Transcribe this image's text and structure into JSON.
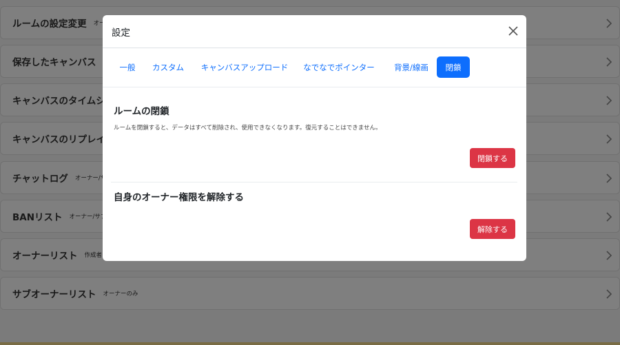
{
  "background": {
    "rows": [
      {
        "title": "ルームの設定変更",
        "note": "オー"
      },
      {
        "title": "保存したキャンバス",
        "note": ""
      },
      {
        "title": "キャンバスのタイムシ",
        "note": ""
      },
      {
        "title": "キャンバスのリプレイ",
        "note": ""
      },
      {
        "title": "チャットログ",
        "note": "オーナー/サ"
      },
      {
        "title": "BANリスト",
        "note": "オーナー/サブ"
      },
      {
        "title": "オーナーリスト",
        "note": "作成者"
      },
      {
        "title": "サブオーナーリスト",
        "note": "オーナーのみ"
      }
    ]
  },
  "modal": {
    "title": "設定",
    "tabs": [
      {
        "label": "一般"
      },
      {
        "label": "カスタム"
      },
      {
        "label": "キャンバスアップロード"
      },
      {
        "label": "なでなでポインター"
      },
      {
        "label": "背景/線画"
      },
      {
        "label": "閉鎖"
      }
    ],
    "active_tab": "閉鎖",
    "close_section": {
      "title": "ルームの閉鎖",
      "description": "ルームを閉鎖すると、データはすべて削除され、使用できなくなります。復元することはできません。",
      "button_label": "閉鎖する"
    },
    "owner_section": {
      "title": "自身のオーナー権限を解除する",
      "button_label": "解除する"
    }
  },
  "colors": {
    "primary": "#0d6efd",
    "danger": "#dc3545",
    "bottom_bar": "#f2d98a"
  }
}
